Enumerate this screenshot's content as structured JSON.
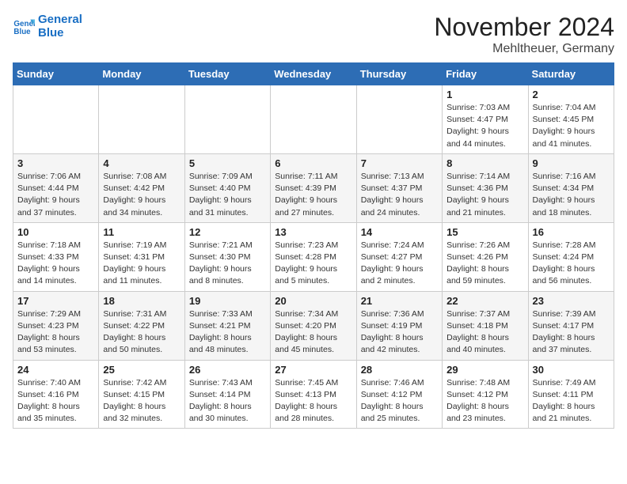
{
  "header": {
    "logo_line1": "General",
    "logo_line2": "Blue",
    "month_year": "November 2024",
    "location": "Mehltheuer, Germany"
  },
  "days_of_week": [
    "Sunday",
    "Monday",
    "Tuesday",
    "Wednesday",
    "Thursday",
    "Friday",
    "Saturday"
  ],
  "weeks": [
    [
      {
        "day": "",
        "info": ""
      },
      {
        "day": "",
        "info": ""
      },
      {
        "day": "",
        "info": ""
      },
      {
        "day": "",
        "info": ""
      },
      {
        "day": "",
        "info": ""
      },
      {
        "day": "1",
        "info": "Sunrise: 7:03 AM\nSunset: 4:47 PM\nDaylight: 9 hours\nand 44 minutes."
      },
      {
        "day": "2",
        "info": "Sunrise: 7:04 AM\nSunset: 4:45 PM\nDaylight: 9 hours\nand 41 minutes."
      }
    ],
    [
      {
        "day": "3",
        "info": "Sunrise: 7:06 AM\nSunset: 4:44 PM\nDaylight: 9 hours\nand 37 minutes."
      },
      {
        "day": "4",
        "info": "Sunrise: 7:08 AM\nSunset: 4:42 PM\nDaylight: 9 hours\nand 34 minutes."
      },
      {
        "day": "5",
        "info": "Sunrise: 7:09 AM\nSunset: 4:40 PM\nDaylight: 9 hours\nand 31 minutes."
      },
      {
        "day": "6",
        "info": "Sunrise: 7:11 AM\nSunset: 4:39 PM\nDaylight: 9 hours\nand 27 minutes."
      },
      {
        "day": "7",
        "info": "Sunrise: 7:13 AM\nSunset: 4:37 PM\nDaylight: 9 hours\nand 24 minutes."
      },
      {
        "day": "8",
        "info": "Sunrise: 7:14 AM\nSunset: 4:36 PM\nDaylight: 9 hours\nand 21 minutes."
      },
      {
        "day": "9",
        "info": "Sunrise: 7:16 AM\nSunset: 4:34 PM\nDaylight: 9 hours\nand 18 minutes."
      }
    ],
    [
      {
        "day": "10",
        "info": "Sunrise: 7:18 AM\nSunset: 4:33 PM\nDaylight: 9 hours\nand 14 minutes."
      },
      {
        "day": "11",
        "info": "Sunrise: 7:19 AM\nSunset: 4:31 PM\nDaylight: 9 hours\nand 11 minutes."
      },
      {
        "day": "12",
        "info": "Sunrise: 7:21 AM\nSunset: 4:30 PM\nDaylight: 9 hours\nand 8 minutes."
      },
      {
        "day": "13",
        "info": "Sunrise: 7:23 AM\nSunset: 4:28 PM\nDaylight: 9 hours\nand 5 minutes."
      },
      {
        "day": "14",
        "info": "Sunrise: 7:24 AM\nSunset: 4:27 PM\nDaylight: 9 hours\nand 2 minutes."
      },
      {
        "day": "15",
        "info": "Sunrise: 7:26 AM\nSunset: 4:26 PM\nDaylight: 8 hours\nand 59 minutes."
      },
      {
        "day": "16",
        "info": "Sunrise: 7:28 AM\nSunset: 4:24 PM\nDaylight: 8 hours\nand 56 minutes."
      }
    ],
    [
      {
        "day": "17",
        "info": "Sunrise: 7:29 AM\nSunset: 4:23 PM\nDaylight: 8 hours\nand 53 minutes."
      },
      {
        "day": "18",
        "info": "Sunrise: 7:31 AM\nSunset: 4:22 PM\nDaylight: 8 hours\nand 50 minutes."
      },
      {
        "day": "19",
        "info": "Sunrise: 7:33 AM\nSunset: 4:21 PM\nDaylight: 8 hours\nand 48 minutes."
      },
      {
        "day": "20",
        "info": "Sunrise: 7:34 AM\nSunset: 4:20 PM\nDaylight: 8 hours\nand 45 minutes."
      },
      {
        "day": "21",
        "info": "Sunrise: 7:36 AM\nSunset: 4:19 PM\nDaylight: 8 hours\nand 42 minutes."
      },
      {
        "day": "22",
        "info": "Sunrise: 7:37 AM\nSunset: 4:18 PM\nDaylight: 8 hours\nand 40 minutes."
      },
      {
        "day": "23",
        "info": "Sunrise: 7:39 AM\nSunset: 4:17 PM\nDaylight: 8 hours\nand 37 minutes."
      }
    ],
    [
      {
        "day": "24",
        "info": "Sunrise: 7:40 AM\nSunset: 4:16 PM\nDaylight: 8 hours\nand 35 minutes."
      },
      {
        "day": "25",
        "info": "Sunrise: 7:42 AM\nSunset: 4:15 PM\nDaylight: 8 hours\nand 32 minutes."
      },
      {
        "day": "26",
        "info": "Sunrise: 7:43 AM\nSunset: 4:14 PM\nDaylight: 8 hours\nand 30 minutes."
      },
      {
        "day": "27",
        "info": "Sunrise: 7:45 AM\nSunset: 4:13 PM\nDaylight: 8 hours\nand 28 minutes."
      },
      {
        "day": "28",
        "info": "Sunrise: 7:46 AM\nSunset: 4:12 PM\nDaylight: 8 hours\nand 25 minutes."
      },
      {
        "day": "29",
        "info": "Sunrise: 7:48 AM\nSunset: 4:12 PM\nDaylight: 8 hours\nand 23 minutes."
      },
      {
        "day": "30",
        "info": "Sunrise: 7:49 AM\nSunset: 4:11 PM\nDaylight: 8 hours\nand 21 minutes."
      }
    ]
  ]
}
